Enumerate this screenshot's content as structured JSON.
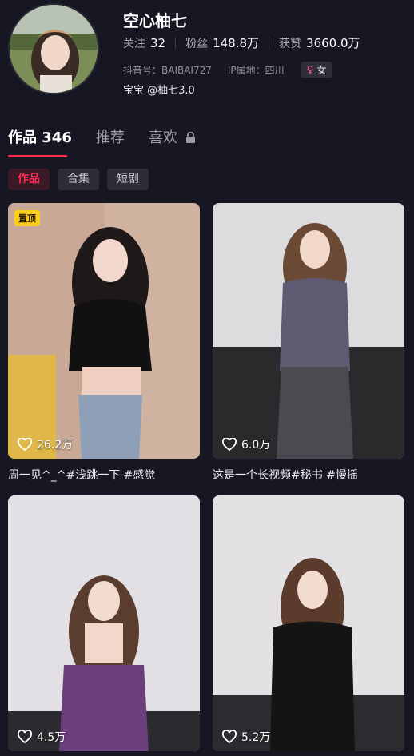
{
  "profile": {
    "name": "空心柚七",
    "stats": [
      {
        "label": "关注",
        "value": "32"
      },
      {
        "label": "粉丝",
        "value": "148.8万"
      },
      {
        "label": "获赞",
        "value": "3660.0万"
      }
    ],
    "douyin_id": "抖音号：BAIBAI727",
    "ip_location": "IP属地：四川",
    "gender": "女",
    "bio": "宝宝 @柚七3.0"
  },
  "tabs": [
    {
      "label": "作品 346"
    },
    {
      "label": "推荐"
    },
    {
      "label": "喜欢"
    }
  ],
  "chips": [
    "作品",
    "合集",
    "短剧"
  ],
  "videos": [
    {
      "badge": "置顶",
      "likes": "26.2万",
      "caption": "周一见^_^#浅跳一下 #感觉"
    },
    {
      "likes": "6.0万",
      "caption": "这是一个长视频#秘书 #慢摇"
    },
    {
      "likes": "4.5万"
    },
    {
      "likes": "5.2万"
    }
  ],
  "colors": {
    "accent": "#fe2c55",
    "background": "#161722",
    "pin_badge": "#facd1e"
  }
}
